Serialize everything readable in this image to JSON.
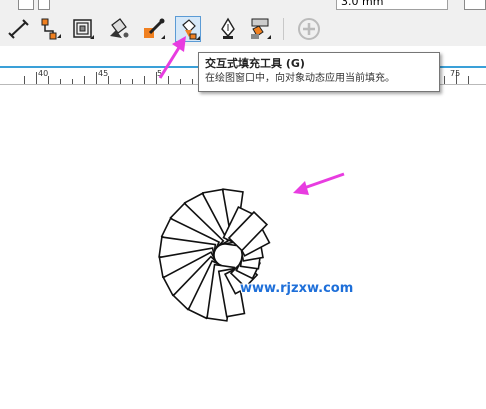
{
  "property_bar": {
    "size_value": "3.0 mm"
  },
  "toolbar": {
    "tools": [
      {
        "name": "dimension-tool-icon"
      },
      {
        "name": "connector-tool-icon"
      },
      {
        "name": "contour-tool-icon"
      },
      {
        "name": "smart-fill-tool-icon"
      },
      {
        "name": "eyedropper-tool-icon"
      },
      {
        "name": "interactive-fill-tool-icon",
        "active": true
      },
      {
        "name": "pen-tool-icon"
      },
      {
        "name": "blend-tool-icon"
      },
      {
        "name": "add-tool-icon"
      }
    ]
  },
  "ruler": {
    "labels": [
      "40",
      "45",
      "5",
      "75"
    ]
  },
  "tooltip": {
    "title": "交互式填充工具 (G)",
    "description": "在绘图窗口中，向对象动态应用当前填充。"
  },
  "watermark": {
    "text": "www.rjzxw.com"
  },
  "colors": {
    "annotation_arrow": "#e83ce0",
    "ruler_line": "#3aa0d8",
    "watermark": "#1e6fd9"
  }
}
